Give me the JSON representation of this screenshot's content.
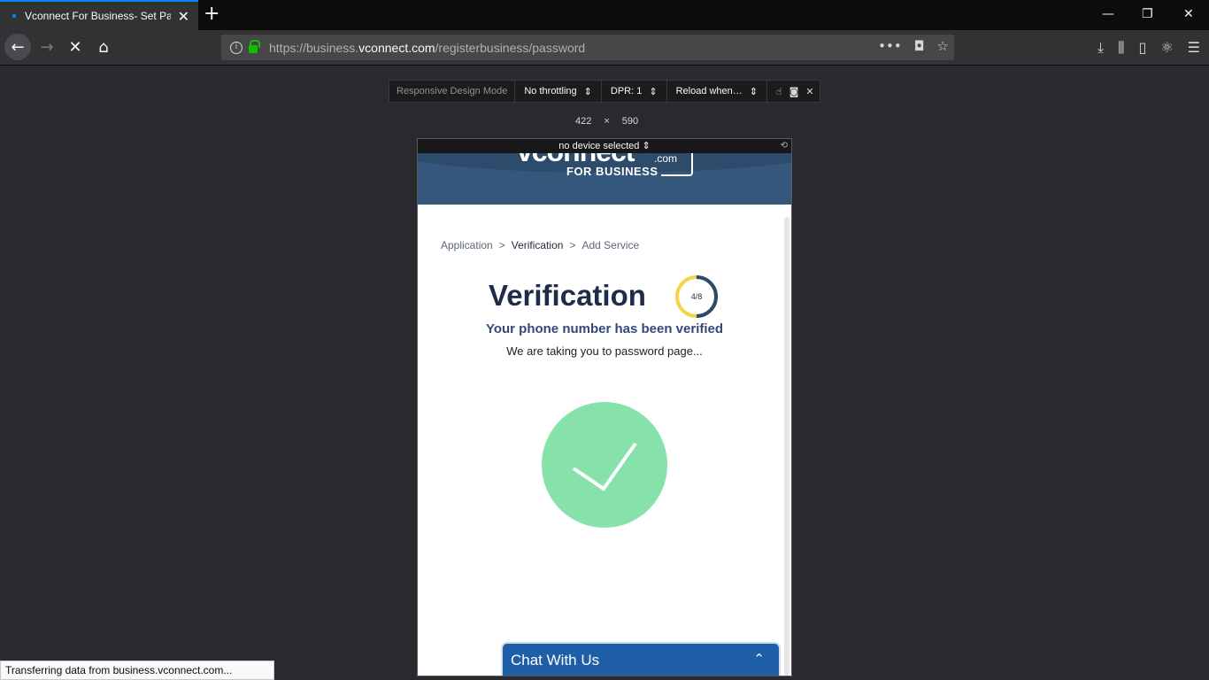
{
  "browser": {
    "tab_title": "Vconnect For Business- Set Password",
    "new_tab_symbol": "+",
    "tab_close_symbol": "✕",
    "window": {
      "minimize": "—",
      "restore": "❐",
      "close": "✕"
    },
    "nav": {
      "back": "←",
      "forward": "→",
      "stop": "✕",
      "home": "⌂"
    },
    "url": {
      "prefix": "https://business.",
      "domain": "vconnect.com",
      "path": "/registerbusiness/password"
    },
    "url_actions": {
      "more": "•••",
      "pocket": "◘",
      "bookmark": "☆"
    },
    "toolbar": {
      "downloads": "⤓",
      "library": "⫼",
      "sidebar": "▯",
      "addon": "⚛",
      "menu": "☰"
    },
    "status_text": "Transferring data from business.vconnect.com..."
  },
  "rdm": {
    "label": "Responsive Design Mode",
    "throttling": "No throttling",
    "dpr": "DPR: 1",
    "reload": "Reload when…",
    "width": "422",
    "times": "×",
    "height": "590",
    "device": "no device selected",
    "icons": {
      "touch": "☝",
      "screenshot": "◙",
      "close": "✕"
    },
    "rotate": "⟲"
  },
  "site": {
    "logo_main": "vconnect",
    "logo_com": ".com",
    "logo_sub": "FOR BUSINESS",
    "breadcrumb": {
      "step1": "Application",
      "step2": "Verification",
      "step3": "Add Service",
      "sep": ">"
    },
    "title": "Verification",
    "progress_label": "4/8",
    "progress_fraction": 0.5,
    "verified_message": "Your phone number has been verified",
    "sub_message": "We are taking you to password page...",
    "chat_label": "Chat With Us",
    "chat_chevron": "⌃"
  },
  "colors": {
    "accent_tab": "#0a84ff",
    "brand_header": "#35577b",
    "check_green": "#86e2aa",
    "ring_yellow": "#f5d547",
    "ring_navy": "#2c4a6e",
    "chat_blue": "#1f5fa8"
  }
}
